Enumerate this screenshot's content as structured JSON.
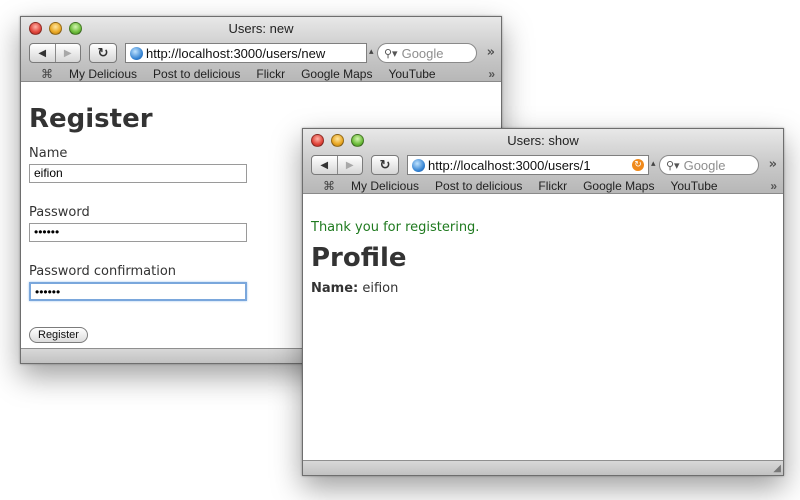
{
  "windows": {
    "new": {
      "title": "Users: new",
      "url": "http://localhost:3000/users/new",
      "search_placeholder": "Google",
      "bookmarks": [
        "My Delicious",
        "Post to delicious",
        "Flickr",
        "Google Maps",
        "YouTube"
      ],
      "page": {
        "heading": "Register",
        "name_label": "Name",
        "name_value": "eifion",
        "password_label": "Password",
        "password_value": "••••••",
        "confirm_label": "Password confirmation",
        "confirm_value": "••••••",
        "submit_label": "Register"
      }
    },
    "show": {
      "title": "Users: show",
      "url": "http://localhost:3000/users/1",
      "search_placeholder": "Google",
      "bookmarks": [
        "My Delicious",
        "Post to delicious",
        "Flickr",
        "Google Maps",
        "YouTube"
      ],
      "page": {
        "notice": "Thank you for registering.",
        "heading": "Profile",
        "name_label": "Name:",
        "name_value": "eifion"
      }
    }
  },
  "glyphs": {
    "back": "◀",
    "forward": "▶",
    "reload": "↻",
    "search": "⚲▾",
    "overflow": "»",
    "bookmarks_book": "⌘",
    "caret": "▴",
    "rss": "↻",
    "grip": "◢"
  },
  "colors": {
    "notice": "#1f7a1f",
    "heading": "#333333",
    "focus_ring": "#7aa7dc"
  }
}
